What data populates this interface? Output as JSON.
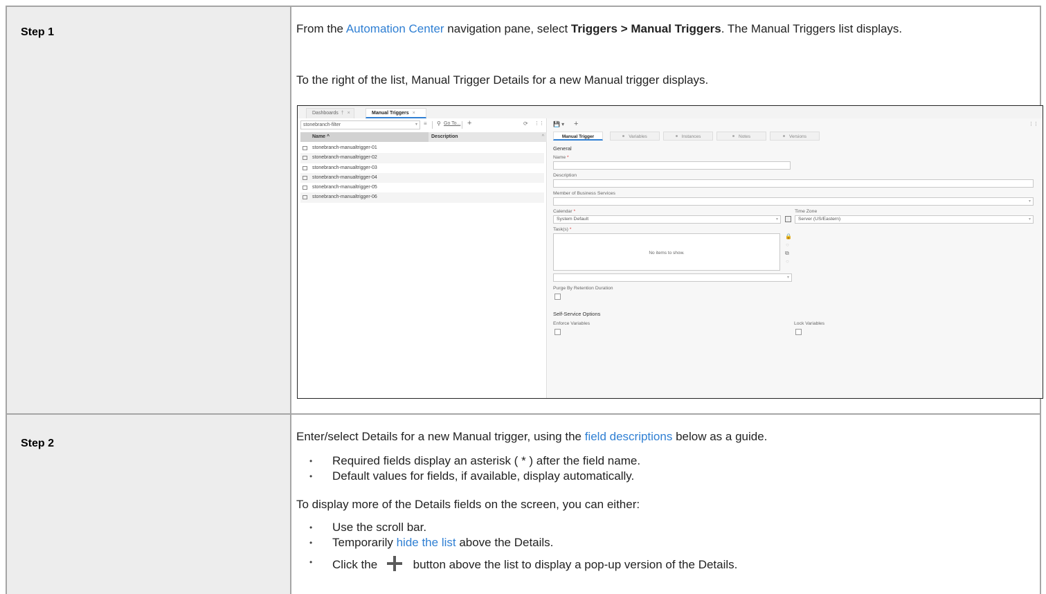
{
  "step1": {
    "label": "Step 1",
    "para1_prefix": "From the ",
    "para1_link": "Automation Center",
    "para1_mid": " navigation pane, select ",
    "para1_bold": "Triggers > Manual Triggers",
    "para1_suffix": ". The Manual Triggers list displays.",
    "para2": "To the right of the list, Manual Trigger Details for a new Manual trigger displays."
  },
  "screenshot": {
    "tabs": [
      {
        "label": "Dashboards",
        "pin": "†",
        "close": "×"
      },
      {
        "label": "Manual Triggers",
        "close": "×"
      }
    ],
    "filter_value": "stonebranch-filter",
    "goto_label": "Go To...",
    "list_columns": {
      "name": "Name ^",
      "description": "Description"
    },
    "list_items": [
      "stonebranch-manualtrigger-01",
      "stonebranch-manualtrigger-02",
      "stonebranch-manualtrigger-03",
      "stonebranch-manualtrigger-04",
      "stonebranch-manualtrigger-05",
      "stonebranch-manualtrigger-06"
    ],
    "detail_tabs": [
      "Manual Trigger",
      "Variables",
      "Instances",
      "Notes",
      "Versions"
    ],
    "section_general": "General",
    "fields": {
      "name": "Name",
      "description": "Description",
      "member_of_business_services": "Member of Business Services",
      "calendar": "Calendar",
      "calendar_value": "System Default",
      "time_zone": "Time Zone",
      "time_zone_value": "Server (US/Eastern)",
      "tasks": "Task(s)",
      "tasks_empty": "No items to show.",
      "purge": "Purge By Retention Duration",
      "required_mark": "*"
    },
    "section_self_service": "Self-Service Options",
    "enforce_variables": "Enforce Variables",
    "lock_variables": "Lock Variables"
  },
  "step2": {
    "label": "Step 2",
    "para1_prefix": "Enter/select Details for a new Manual trigger, using the ",
    "para1_link": "field descriptions",
    "para1_suffix": " below as a guide.",
    "bullets1": [
      "Required fields display an asterisk ( * ) after the field name.",
      "Default values for fields, if available, display automatically."
    ],
    "para2": "To display more of the Details fields on the screen, you can either:",
    "bullet_scroll": "Use the scroll bar.",
    "bullet_hide_prefix": "Temporarily ",
    "bullet_hide_link": "hide the list",
    "bullet_hide_suffix": " above the Details.",
    "bullet_click_prefix": "Click the ",
    "bullet_click_suffix": " button above the list to display a pop-up version of the Details."
  }
}
